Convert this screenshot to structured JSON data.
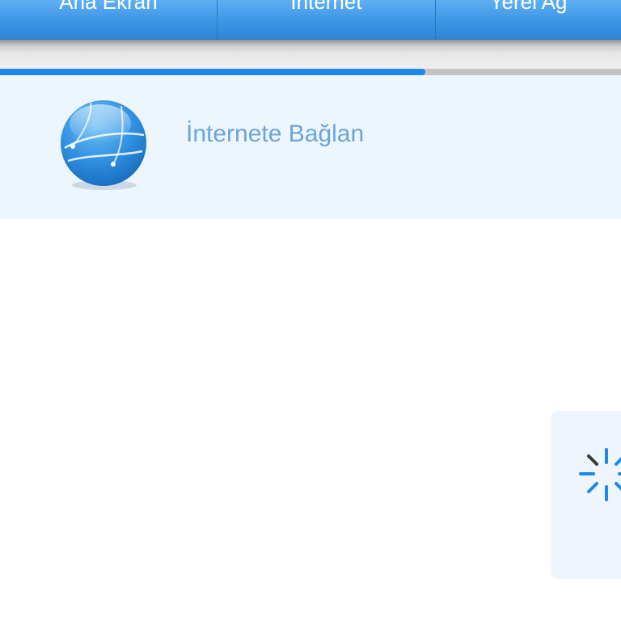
{
  "tabs": [
    {
      "label": "Ana Ekran"
    },
    {
      "label": "İnternet"
    },
    {
      "label": "Yerel Ağ"
    }
  ],
  "progress": {
    "value": 0.685
  },
  "connect": {
    "label": "İnternete Bağlan",
    "icon": "globe-icon"
  },
  "loading": {
    "icon": "spinner-icon"
  },
  "colors": {
    "tab_bar": "#3d95e6",
    "progress_fill": "#1e88ea",
    "progress_track": "#c3c3c6",
    "panel_bg": "#eef6fd",
    "label_text": "#6aa5da"
  }
}
